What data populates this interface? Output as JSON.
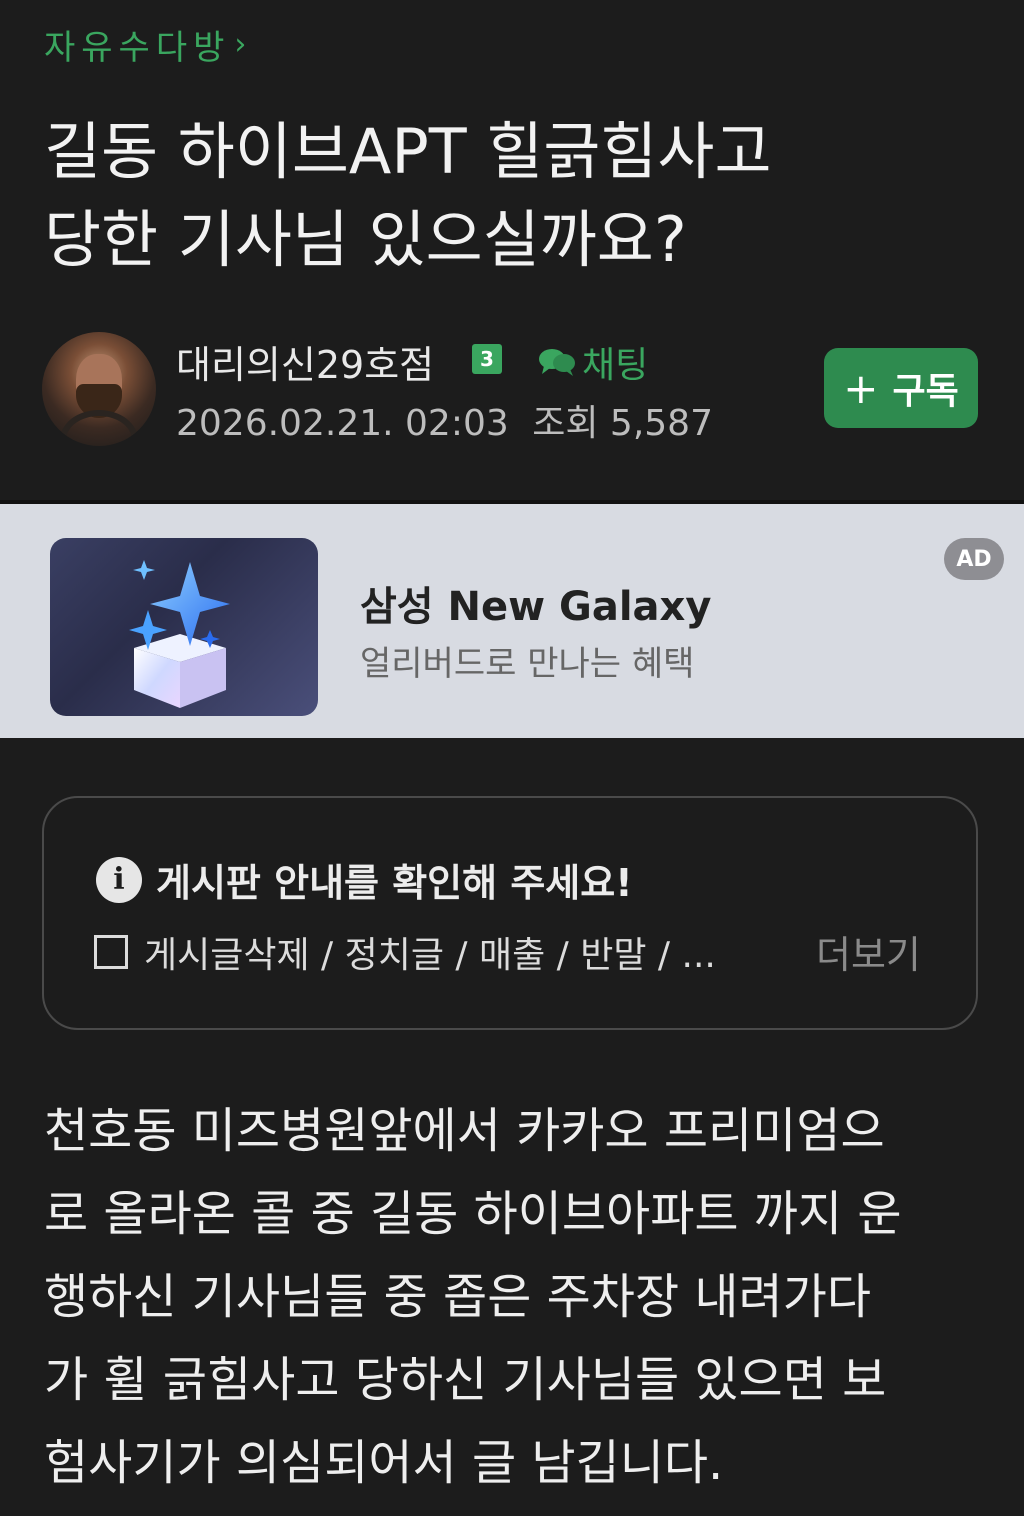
{
  "board": {
    "name": "자유수다방",
    "chevron": "›"
  },
  "post": {
    "title": "길동 하이브APT 힐긁힘사고\n당한 기사님 있으실까요?",
    "body": "천호동 미즈병원앞에서 카카오 프리미엄으\n로 올라온 콜 중 길동 하이브아파트 까지 운\n행하신 기사님들 중 좁은 주차장 내려가다\n가 휠 긁힘사고 당하신 기사님들 있으면 보\n험사기가 의심되어서 글 남깁니다."
  },
  "author": {
    "name": "대리의신29호점",
    "level": "3",
    "chat_label": "채팅",
    "date": "2026.02.21. 02:03",
    "views_label": "조회",
    "views": "5,587"
  },
  "subscribe": {
    "plus": "+",
    "label": "구독"
  },
  "ad": {
    "title": "삼성 New Galaxy",
    "subtitle": "얼리버드로 만나는 혜택",
    "badge": "AD"
  },
  "notice": {
    "heading": "게시판 안내를 확인해 주세요!",
    "rules": "게시글삭제 / 정치글 / 매출 / 반말 / ...",
    "more": "더보기"
  },
  "colors": {
    "background": "#1c1c1c",
    "accent": "#3aa65f",
    "button": "#2e8b4f",
    "ad_background": "#d8dbe2"
  },
  "icons": {
    "chat": "chat-bubbles-icon",
    "info": "info-icon",
    "checkbox": "checkbox-icon"
  }
}
